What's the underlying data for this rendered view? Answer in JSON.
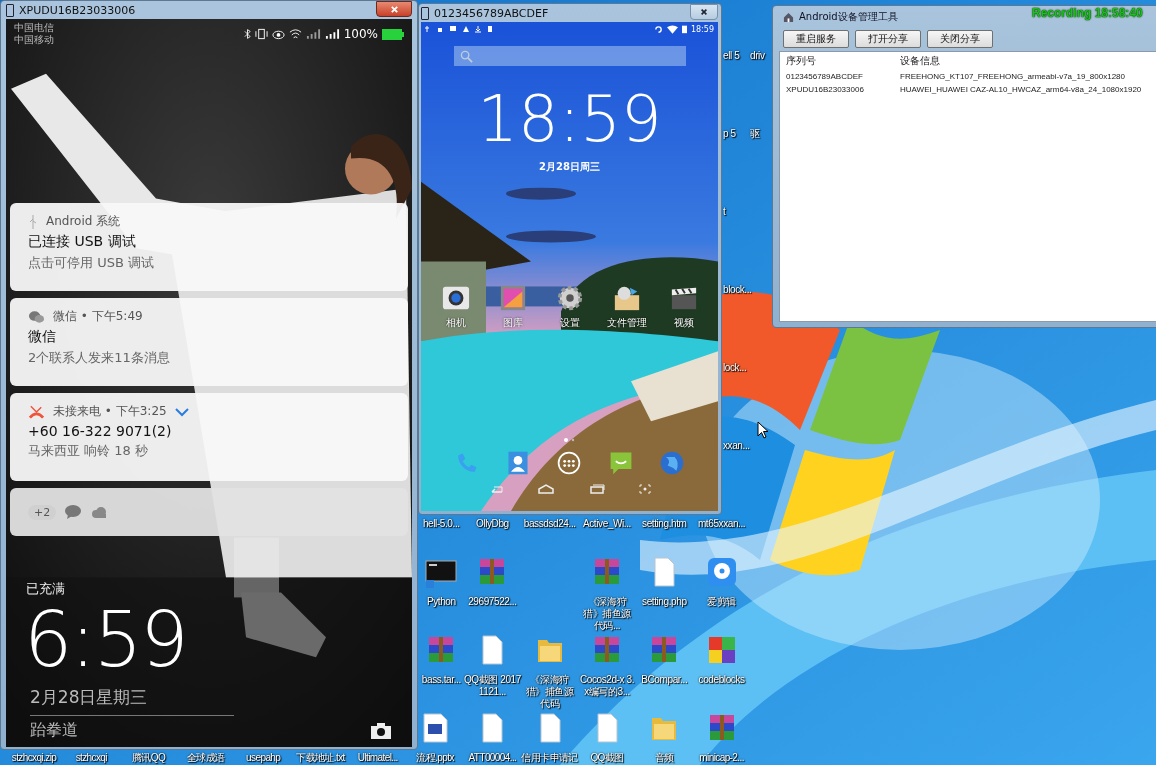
{
  "desktop_icons": [
    {
      "label": "ell 5",
      "kind": "partial"
    },
    {
      "label": "driv",
      "kind": "partial"
    },
    {
      "label": "p 5",
      "kind": "partial"
    },
    {
      "label": "驱",
      "kind": "partial"
    },
    {
      "label": "t",
      "kind": "partial"
    },
    {
      "label": "block...",
      "kind": "partial"
    },
    {
      "label": "lock...",
      "kind": "partial"
    },
    {
      "label": "xxan...",
      "kind": "partial"
    },
    {
      "label": "hell-5.0...",
      "kind": "label"
    },
    {
      "label": "OllyDbg",
      "kind": "label"
    },
    {
      "label": "bassdsd24...",
      "kind": "label"
    },
    {
      "label": "Active_Wi...",
      "kind": "label"
    },
    {
      "label": "setting.htm",
      "kind": "label"
    },
    {
      "label": "mt65xxan...",
      "kind": "label"
    },
    {
      "label": "Python",
      "kind": "terminal"
    },
    {
      "label": "29697522...",
      "kind": "rar"
    },
    {
      "label": "《深海狩猎》捕鱼源代码...",
      "kind": "rar"
    },
    {
      "label": "setting.php",
      "kind": "doc"
    },
    {
      "label": "爱剪辑",
      "kind": "video"
    },
    {
      "label": "bass.tar...",
      "kind": "rar"
    },
    {
      "label": "QQ截图 20171121...",
      "kind": "doc"
    },
    {
      "label": "《深海狩猎》捕鱼源代码",
      "kind": "folder"
    },
    {
      "label": "Cocos2d-x 3.x编写的3...",
      "kind": "rar"
    },
    {
      "label": "BCompar...",
      "kind": "rar"
    },
    {
      "label": "codeblocks",
      "kind": "blocks"
    },
    {
      "label": "stzhcxqi.zip",
      "kind": "label"
    },
    {
      "label": "stzhcxqi",
      "kind": "label"
    },
    {
      "label": "腾讯QQ",
      "kind": "label"
    },
    {
      "label": "全球成语",
      "kind": "label"
    },
    {
      "label": "usepahp",
      "kind": "label"
    },
    {
      "label": "下载地址.txt",
      "kind": "label"
    },
    {
      "label": "Ultimatel...",
      "kind": "label"
    },
    {
      "label": "流程.pptx",
      "kind": "slides"
    },
    {
      "label": "ATT00004...",
      "kind": "doc"
    },
    {
      "label": "信用卡申请记",
      "kind": "doc"
    },
    {
      "label": "QQ截图",
      "kind": "doc"
    },
    {
      "label": "音频",
      "kind": "folder"
    },
    {
      "label": "minicap-2...",
      "kind": "rar"
    }
  ],
  "left_phone": {
    "title": "XPUDU16B23033006",
    "carriers": [
      "中国电信",
      "中国移动"
    ],
    "battery": "100%",
    "notifications": [
      {
        "kind": "system",
        "app": "Android 系统",
        "title": "已连接 USB 调试",
        "text": "点击可停用 USB 调试"
      },
      {
        "kind": "wechat",
        "app": "微信 • 下午5:49",
        "title": "微信",
        "text": "2个联系人发来11条消息"
      },
      {
        "kind": "missed_call",
        "app": "未接来电 • 下午3:25",
        "title": "+60 16-322 9071(2)",
        "text": "马来西亚 响铃 18 秒"
      },
      {
        "kind": "more",
        "count": "+2"
      }
    ],
    "charge_status": "已充满",
    "clock": "6:59",
    "date": "2月28日星期三",
    "signature": "跆拳道"
  },
  "middle_phone": {
    "title": "0123456789ABCDEF",
    "status_time": "18:59",
    "clock": "18:59",
    "date": "2月28日周三",
    "apps": [
      {
        "label": "相机",
        "kind": "camera"
      },
      {
        "label": "图库",
        "kind": "gallery"
      },
      {
        "label": "设置",
        "kind": "settings"
      },
      {
        "label": "文件管理",
        "kind": "files"
      },
      {
        "label": "视频",
        "kind": "video"
      }
    ],
    "dock": [
      {
        "kind": "phone"
      },
      {
        "kind": "contacts"
      },
      {
        "kind": "apps"
      },
      {
        "kind": "messaging"
      },
      {
        "kind": "browser"
      }
    ]
  },
  "tool_window": {
    "title": "Android设备管理工具",
    "buttons": [
      "重启服务",
      "打开分享",
      "关闭分享"
    ],
    "columns": [
      "序列号",
      "设备信息"
    ],
    "rows": [
      [
        "0123456789ABCDEF",
        "FREEHONG_KT107_FREEHONG_armeabi-v7a_19_800x1280"
      ],
      [
        "XPUDU16B23033006",
        "HUAWEI_HUAWEI CAZ-AL10_HWCAZ_arm64-v8a_24_1080x1920"
      ]
    ]
  },
  "recording": "Recording 18:58:40"
}
